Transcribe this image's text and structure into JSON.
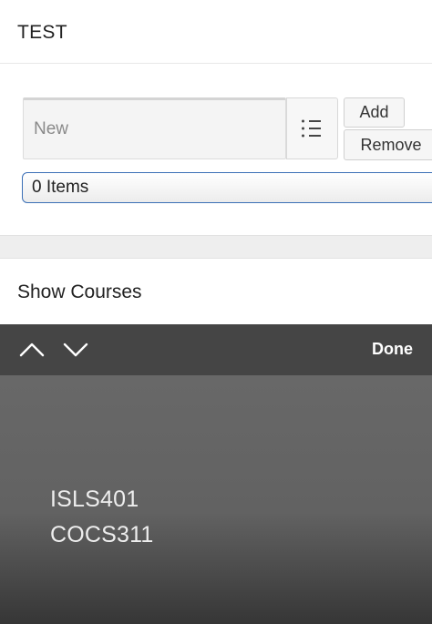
{
  "test_region": {
    "title": "TEST",
    "input": {
      "placeholder": "New",
      "value": ""
    },
    "add_label": "Add",
    "remove_label": "Remove",
    "items_select": {
      "selected": "0 Items"
    }
  },
  "courses_region": {
    "title": "Show Courses"
  },
  "picker": {
    "toolbar": {
      "prev_icon": "chevron-up-icon",
      "next_icon": "chevron-down-icon",
      "done_label": "Done"
    },
    "options": [
      "ISLS401",
      "COCS311"
    ]
  },
  "colors": {
    "select_border": "#3b6fb6",
    "toolbar_bg": "#454545",
    "picker_bg": "#626262"
  }
}
